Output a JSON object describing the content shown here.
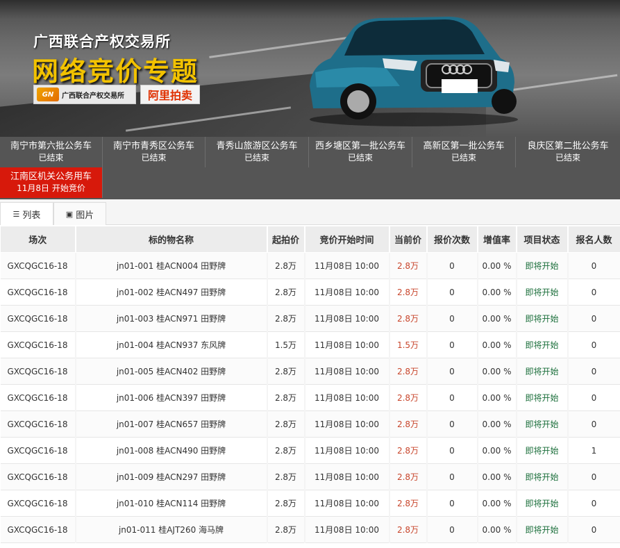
{
  "banner": {
    "org_title": "广西联合产权交易所",
    "campaign_title": "网络竞价专题",
    "logo_org_text": "广西联合产权交易所",
    "logo_org_mark": "GN",
    "logo_ali_text": "阿里拍卖"
  },
  "nav": {
    "items": [
      {
        "label": "南宁市第六批公务车",
        "status": "已结束"
      },
      {
        "label": "南宁市青秀区公务车",
        "status": "已结束"
      },
      {
        "label": "青秀山旅游区公务车",
        "status": "已结束"
      },
      {
        "label": "西乡塘区第一批公务车",
        "status": "已结束"
      },
      {
        "label": "高新区第一批公务车",
        "status": "已结束"
      },
      {
        "label": "良庆区第二批公务车",
        "status": "已结束"
      },
      {
        "label": "江南区机关公务用车",
        "status": "11月8日 开始竞价"
      }
    ]
  },
  "view": {
    "list_label": "列表",
    "image_label": "图片"
  },
  "table": {
    "headers": [
      "场次",
      "标的物名称",
      "起拍价",
      "竞价开始时间",
      "当前价",
      "报价次数",
      "增值率",
      "项目状态",
      "报名人数"
    ],
    "rows": [
      [
        "GXCQGC16-18",
        "jn01-001 桂ACN004 田野牌",
        "2.8万",
        "11月08日 10:00",
        "2.8万",
        "0",
        "0.00 %",
        "即将开始",
        "0"
      ],
      [
        "GXCQGC16-18",
        "jn01-002 桂ACN497 田野牌",
        "2.8万",
        "11月08日 10:00",
        "2.8万",
        "0",
        "0.00 %",
        "即将开始",
        "0"
      ],
      [
        "GXCQGC16-18",
        "jn01-003 桂ACN971 田野牌",
        "2.8万",
        "11月08日 10:00",
        "2.8万",
        "0",
        "0.00 %",
        "即将开始",
        "0"
      ],
      [
        "GXCQGC16-18",
        "jn01-004 桂ACN937 东风牌",
        "1.5万",
        "11月08日 10:00",
        "1.5万",
        "0",
        "0.00 %",
        "即将开始",
        "0"
      ],
      [
        "GXCQGC16-18",
        "jn01-005 桂ACN402 田野牌",
        "2.8万",
        "11月08日 10:00",
        "2.8万",
        "0",
        "0.00 %",
        "即将开始",
        "0"
      ],
      [
        "GXCQGC16-18",
        "jn01-006 桂ACN397 田野牌",
        "2.8万",
        "11月08日 10:00",
        "2.8万",
        "0",
        "0.00 %",
        "即将开始",
        "0"
      ],
      [
        "GXCQGC16-18",
        "jn01-007 桂ACN657 田野牌",
        "2.8万",
        "11月08日 10:00",
        "2.8万",
        "0",
        "0.00 %",
        "即将开始",
        "0"
      ],
      [
        "GXCQGC16-18",
        "jn01-008 桂ACN490 田野牌",
        "2.8万",
        "11月08日 10:00",
        "2.8万",
        "0",
        "0.00 %",
        "即将开始",
        "1"
      ],
      [
        "GXCQGC16-18",
        "jn01-009 桂ACN297 田野牌",
        "2.8万",
        "11月08日 10:00",
        "2.8万",
        "0",
        "0.00 %",
        "即将开始",
        "0"
      ],
      [
        "GXCQGC16-18",
        "jn01-010 桂ACN114 田野牌",
        "2.8万",
        "11月08日 10:00",
        "2.8万",
        "0",
        "0.00 %",
        "即将开始",
        "0"
      ],
      [
        "GXCQGC16-18",
        "jn01-011 桂AJT260 海马牌",
        "2.8万",
        "11月08日 10:00",
        "2.8万",
        "0",
        "0.00 %",
        "即将开始",
        "0"
      ]
    ]
  },
  "colors": {
    "nav_bg": "#555555",
    "active_tab": "#d7190b",
    "price": "#c8452b",
    "status": "#1a6e3a",
    "title_yellow": "#f2c200"
  }
}
